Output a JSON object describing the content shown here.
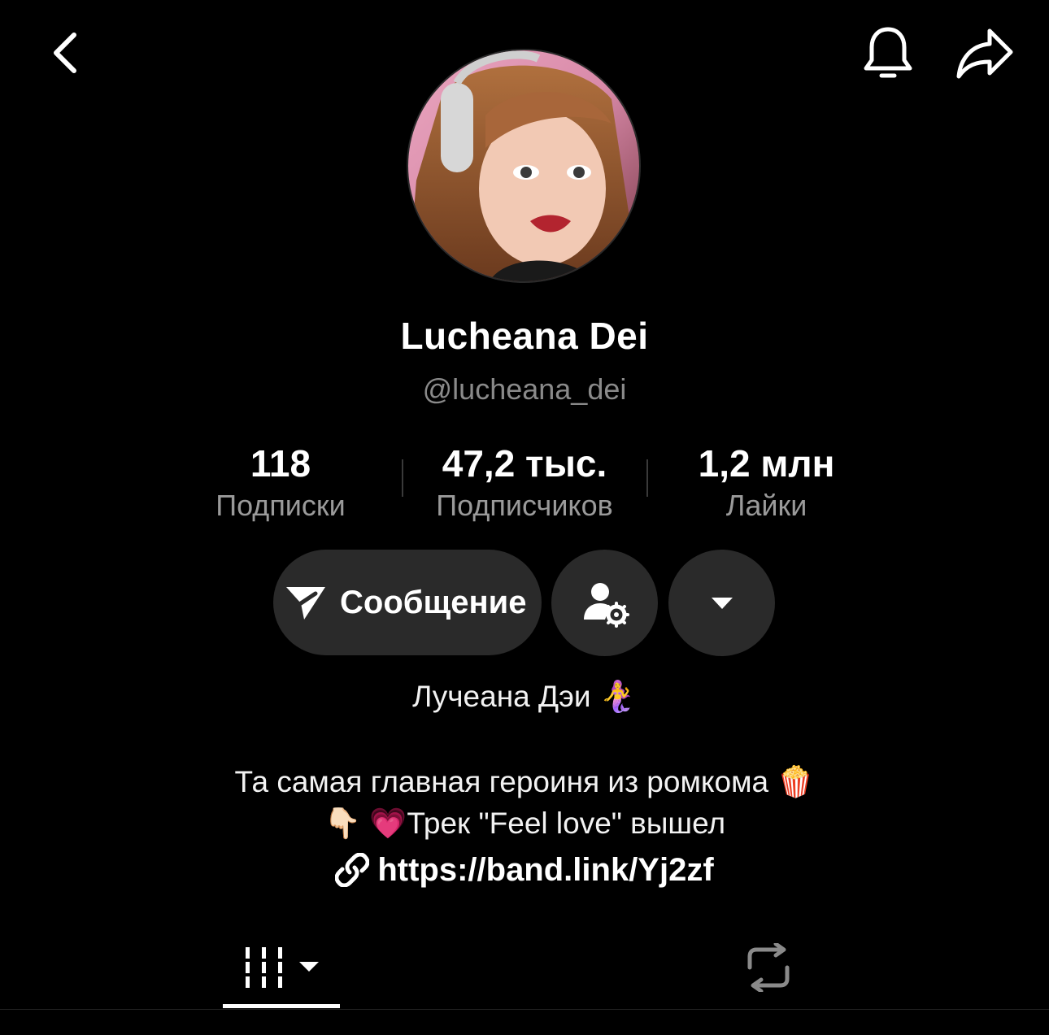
{
  "header": {
    "back_icon": "chevron-left-icon",
    "notifications_icon": "bell-icon",
    "share_icon": "share-arrow-icon"
  },
  "profile": {
    "display_name": "Lucheana Dei",
    "username": "@lucheana_dei"
  },
  "stats": [
    {
      "value": "118",
      "label": "Подписки"
    },
    {
      "value": "47,2 тыс.",
      "label": "Подписчиков"
    },
    {
      "value": "1,2 млн",
      "label": "Лайки"
    }
  ],
  "actions": {
    "message_label": "Сообщение",
    "friends_icon": "user-settings-icon",
    "more_icon": "caret-down-icon"
  },
  "bio": {
    "name_line": "Лучеана Дэи 🧜‍♀️",
    "line1": "Та самая главная героиня из ромкома 🍿",
    "line2": "👇🏻 💗Трек \"Feel love\" вышел",
    "link": "https://band.link/Yj2zf"
  },
  "tabs": {
    "videos_icon": "grid-icon",
    "reposts_icon": "repost-icon"
  },
  "colors": {
    "background": "#000000",
    "button_bg": "#2a2a2a",
    "secondary_text": "#8a8a8a"
  }
}
